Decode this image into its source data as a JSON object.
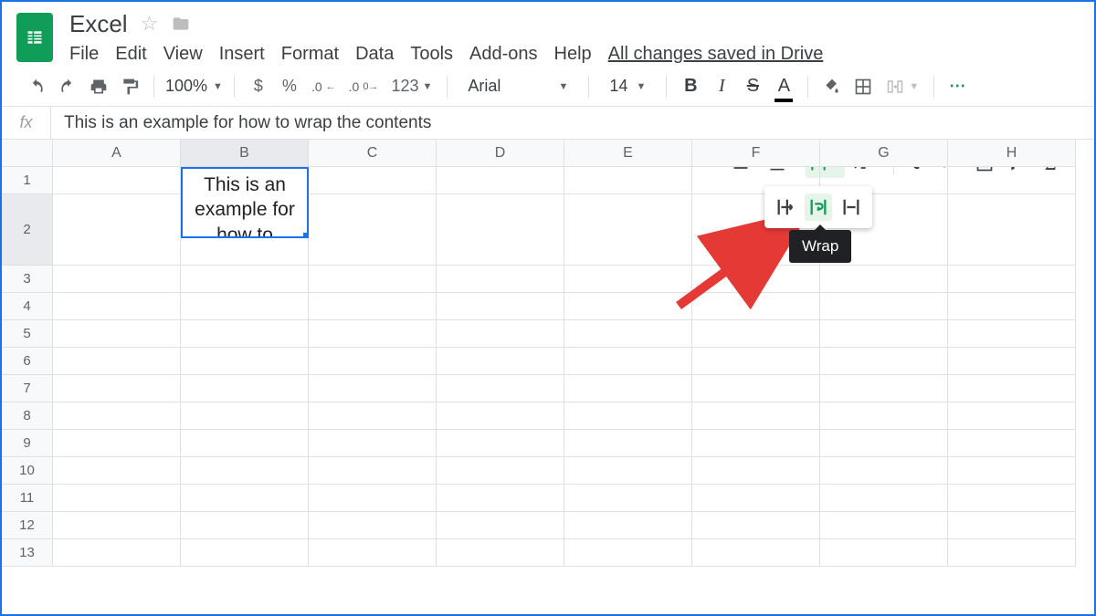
{
  "doc": {
    "title": "Excel"
  },
  "menu": {
    "file": "File",
    "edit": "Edit",
    "view": "View",
    "insert": "Insert",
    "format": "Format",
    "data": "Data",
    "tools": "Tools",
    "addons": "Add-ons",
    "help": "Help",
    "saved": "All changes saved in Drive"
  },
  "toolbar": {
    "zoom": "100%",
    "currency": "$",
    "percent": "%",
    "dec_dec": ".0",
    "inc_dec": ".00",
    "more_formats": "123",
    "font": "Arial",
    "font_size": "14",
    "bold": "B",
    "italic": "I",
    "strike": "S",
    "textcolor": "A"
  },
  "formula": {
    "fx": "fx",
    "value": "This is an example for how to wrap the contents"
  },
  "grid": {
    "cols": [
      "A",
      "B",
      "C",
      "D",
      "E",
      "F",
      "G",
      "H"
    ],
    "rows": [
      "1",
      "2",
      "3",
      "4",
      "5",
      "6",
      "7",
      "8",
      "9",
      "10",
      "11",
      "12",
      "13"
    ],
    "selected_col": "B",
    "selected_row": "2",
    "cell_text": "This is an example for how to"
  },
  "tooltip": "Wrap"
}
